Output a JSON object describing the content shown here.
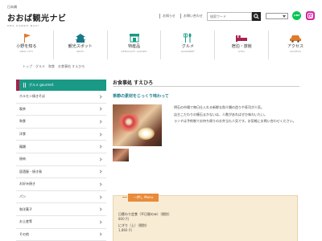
{
  "header": {
    "logo_sub": "日本橋",
    "logo_main": "おおば観光ナビ",
    "logo_en": "OBA KANKO NAVI",
    "links": [
      "お知らせ",
      "お問い合わせ"
    ],
    "search_placeholder": "検索ワード",
    "line_label": "LINE"
  },
  "nav": [
    {
      "jp": "小野を知る",
      "en": "ONO CITY",
      "icon": "flag-icon",
      "color": "#e07a2a"
    },
    {
      "jp": "観光スポット",
      "en": "SPOT",
      "icon": "castle-icon",
      "color": "#1a7a8a"
    },
    {
      "jp": "特産品",
      "en": "SPECIALTY GOODS",
      "icon": "shop-icon",
      "color": "#1a9a86"
    },
    {
      "jp": "グルメ",
      "en": "GOURMET",
      "icon": "cutlery-icon",
      "color": "#1a9a86"
    },
    {
      "jp": "宿泊・旅館",
      "en": "STAY",
      "icon": "bed-icon",
      "color": "#a8224b"
    },
    {
      "jp": "アクセス",
      "en": "ACCESS",
      "icon": "car-icon",
      "color": "#e07a2a"
    }
  ],
  "breadcrumb": [
    "トップ",
    "グルメ",
    "和食",
    "お食事処 すえひろ"
  ],
  "sidebar": {
    "head_label": "グルメ gourmet",
    "items": [
      "ホルモン焼きそば",
      "喫茶",
      "和食",
      "洋食",
      "麺類",
      "焼肉",
      "居酒屋・焼き鳥",
      "お好み焼き",
      "パン",
      "和洋菓子",
      "お土産等",
      "その他"
    ]
  },
  "main": {
    "title": "お食事処 すえひろ",
    "catch": "季節の素材をじっくり味わって",
    "desc": [
      "明石の市場で毎日仕入れる新鮮な魚介類の造りや寿司が人気。",
      "店主こだわりの懐石まかないは、人数があればぜひ味わいたい。",
      "ランチは予約制でお持ち帰りのお弁当も人気です。お気軽にお問い合わせください。"
    ]
  },
  "menu": {
    "tag": "一押し Menu",
    "items": [
      {
        "name": "日替わり定食（平日昼のみ）（税別）",
        "price": "800 円"
      },
      {
        "name": "にぎり（上）（税別）",
        "price": "1,860 円"
      }
    ]
  }
}
